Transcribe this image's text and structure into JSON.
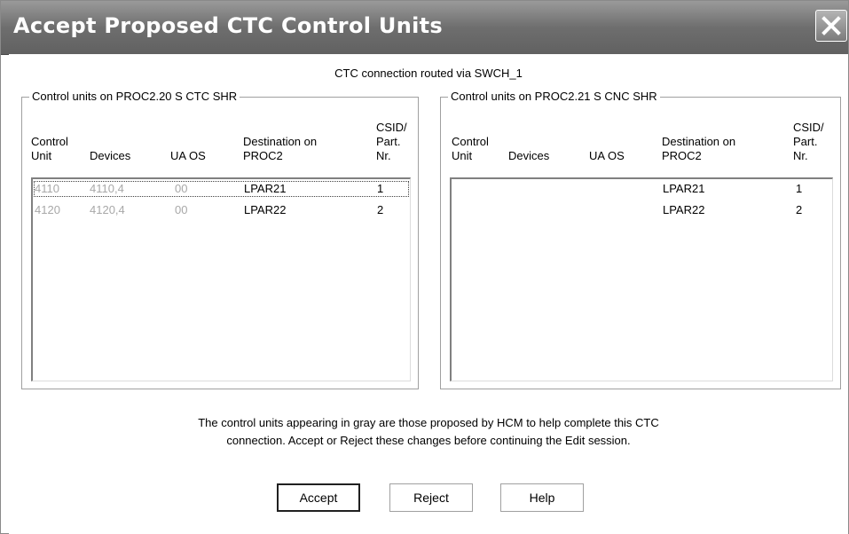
{
  "window": {
    "title": "Accept Proposed CTC Control Units"
  },
  "route_text": "CTC connection routed via SWCH_1",
  "left_group": {
    "legend": "Control units on PROC2.20 S CTC SHR",
    "headers": {
      "cu1": "Control",
      "cu2": "Unit",
      "devices": "Devices",
      "uaos": "UA OS",
      "dest1": "Destination on",
      "dest2": "PROC2",
      "csid1": "CSID/",
      "csid2": "Part.",
      "csid3": "Nr."
    },
    "rows": [
      {
        "control_unit": "4110",
        "devices": "4110,4",
        "ua": "00",
        "os": "",
        "destination": "LPAR21",
        "csid": "1"
      },
      {
        "control_unit": "4120",
        "devices": "4120,4",
        "ua": "00",
        "os": "",
        "destination": "LPAR22",
        "csid": "2"
      }
    ]
  },
  "right_group": {
    "legend": "Control units on PROC2.21 S CNC SHR",
    "headers": {
      "cu1": "Control",
      "cu2": "Unit",
      "devices": "Devices",
      "uaos": "UA OS",
      "dest1": "Destination on",
      "dest2": "PROC2",
      "csid1": "CSID/",
      "csid2": "Part.",
      "csid3": "Nr."
    },
    "rows": [
      {
        "control_unit": "",
        "devices": "",
        "ua": "",
        "os": "",
        "destination": "LPAR21",
        "csid": "1"
      },
      {
        "control_unit": "",
        "devices": "",
        "ua": "",
        "os": "",
        "destination": "LPAR22",
        "csid": "2"
      }
    ]
  },
  "note": {
    "line1": "The control units appearing in gray are those proposed by HCM to help complete this CTC",
    "line2": "connection.  Accept or Reject these changes before continuing the Edit session."
  },
  "buttons": {
    "accept": "Accept",
    "reject": "Reject",
    "help": "Help"
  },
  "icons": {
    "close": "close-icon"
  }
}
